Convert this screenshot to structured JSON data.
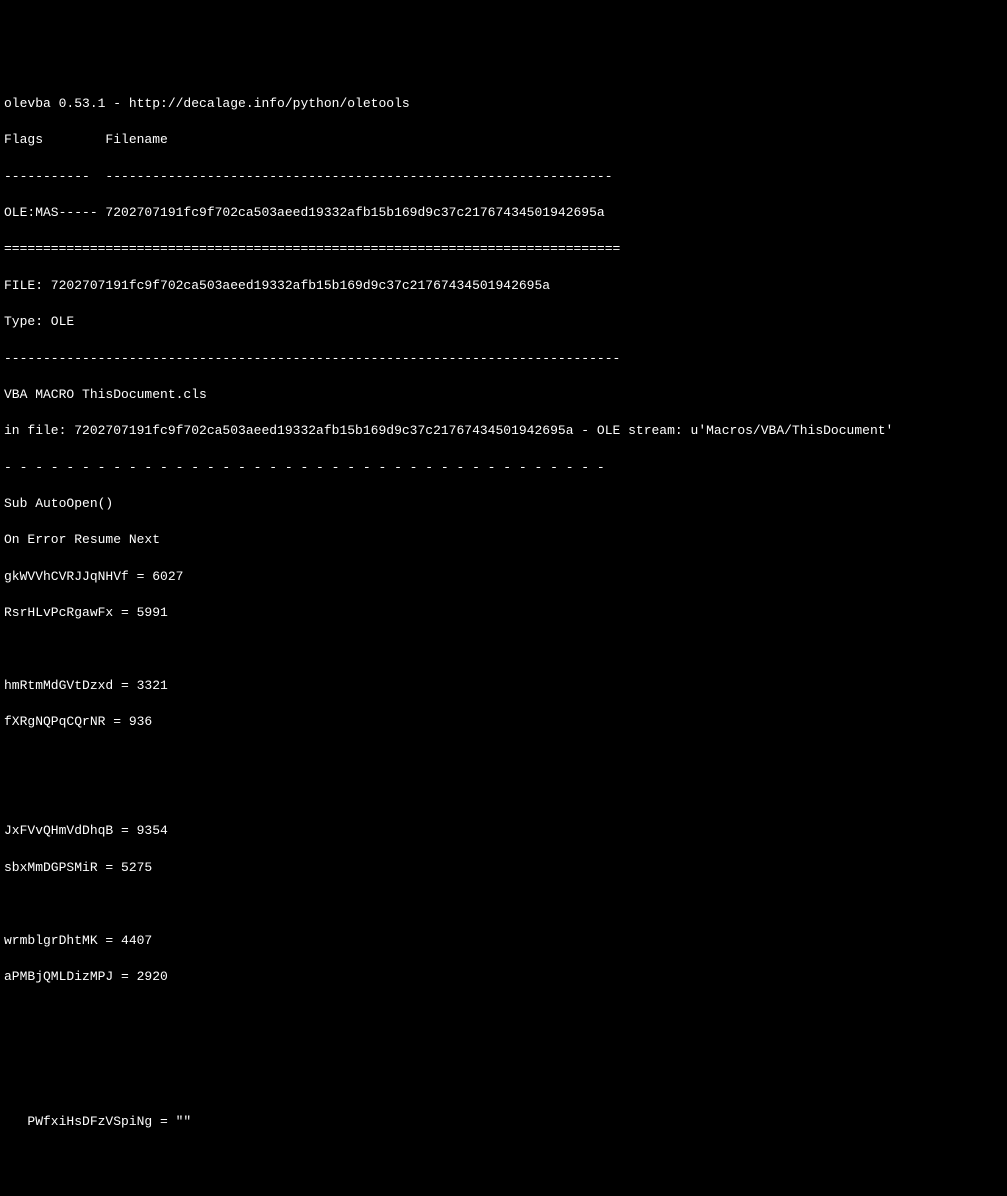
{
  "terminal": {
    "lines": {
      "header": "olevba 0.53.1 - http://decalage.info/python/oletools",
      "columns": "Flags        Filename                                                         ",
      "dash_sep": "-----------  -----------------------------------------------------------------",
      "flags_line": "OLE:MAS----- 7202707191fc9f702ca503aeed19332afb15b169d9c37c21767434501942695a",
      "equals_sep": "===============================================================================",
      "file_line": "FILE: 7202707191fc9f702ca503aeed19332afb15b169d9c37c21767434501942695a",
      "type_line": "Type: OLE",
      "dash_long": "-------------------------------------------------------------------------------",
      "vba_macro": "VBA MACRO ThisDocument.cls",
      "in_file": "in file: 7202707191fc9f702ca503aeed19332afb15b169d9c37c21767434501942695a - OLE stream: u'Macros/VBA/ThisDocument'",
      "spaced_dash": "- - - - - - - - - - - - - - - - - - - - - - - - - - - - - - - - - - - - - - - ",
      "sub_open": "Sub AutoOpen()",
      "on_error": "On Error Resume Next",
      "var1": "gkWVVhCVRJJqNHVf = 6027",
      "var2": "RsrHLvPcRgawFx = 5991",
      "var3": "hmRtmMdGVtDzxd = 3321",
      "var4": "fXRgNQPqCQrNR = 936",
      "var5": "JxFVvQHmVdDhqB = 9354",
      "var6": "sbxMmDGPSMiR = 5275",
      "var7": "wrmblgrDhtMK = 4407",
      "var8": "aPMBjQMLDizMPJ = 2920",
      "var9": "   PWfxiHsDFzVSpiNg = \"\""
    }
  }
}
